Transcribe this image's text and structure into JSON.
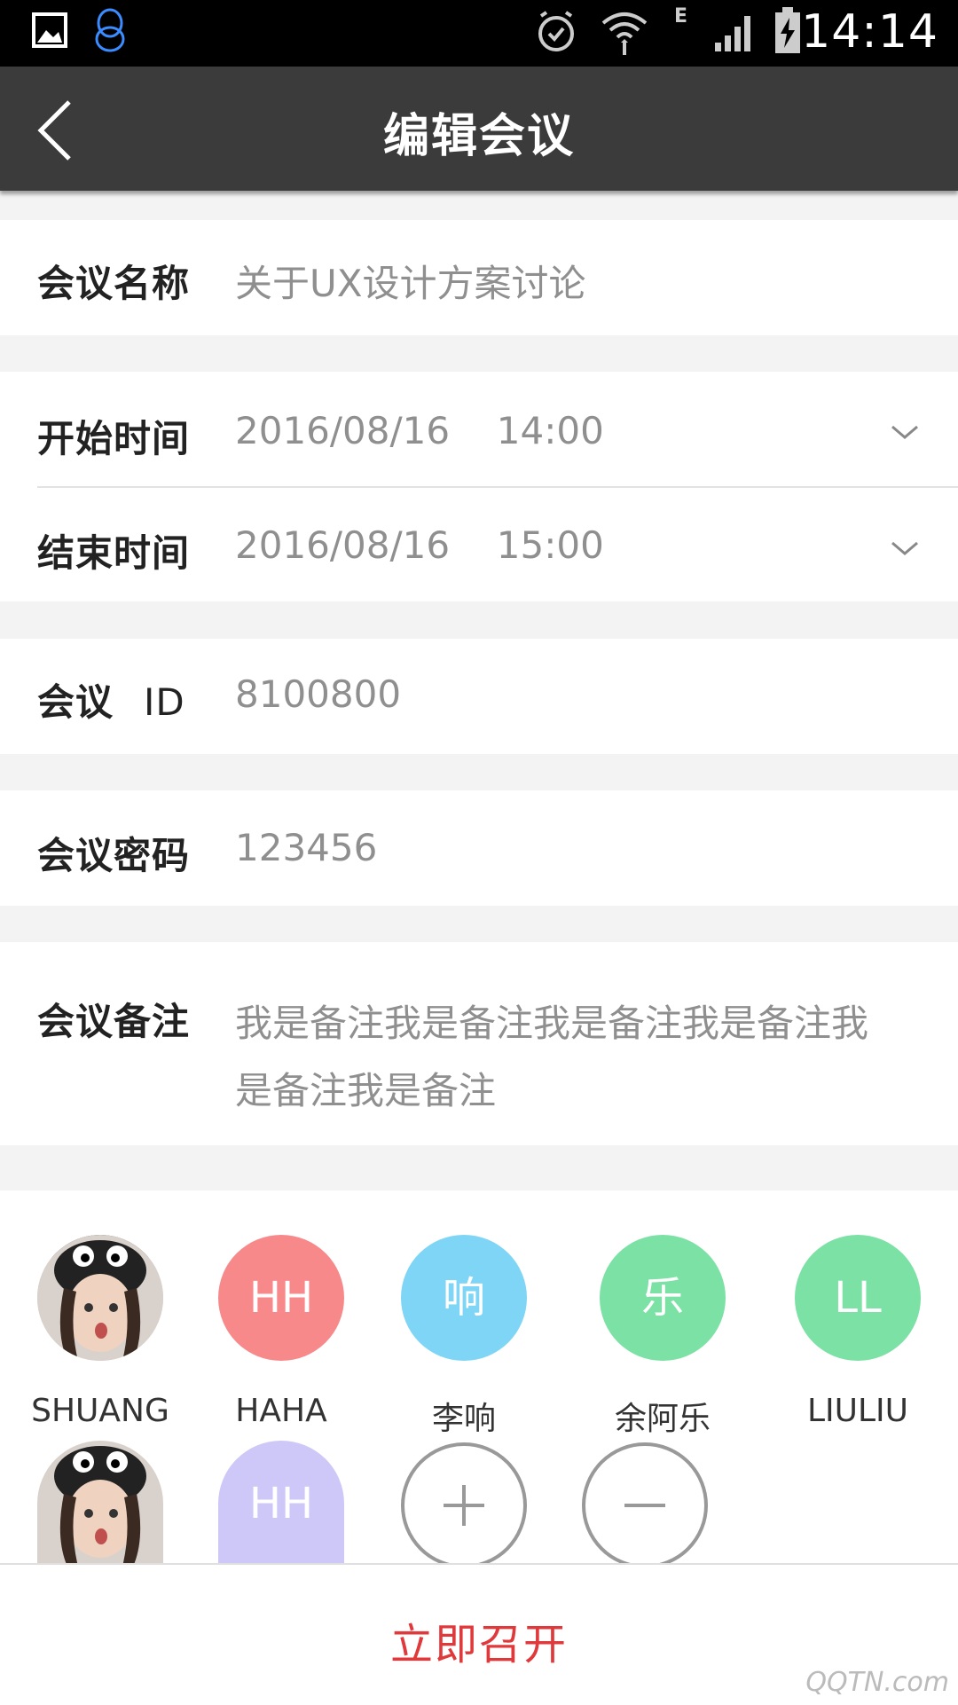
{
  "status_bar": {
    "time": "14:14",
    "network_label": "E",
    "icons": [
      "image-icon",
      "qq-icon",
      "alarm-icon",
      "wifi-icon",
      "signal-icon",
      "battery-charging-icon"
    ]
  },
  "header": {
    "title": "编辑会议",
    "back_icon": "chevron-left-icon"
  },
  "form": {
    "name": {
      "label": "会议名称",
      "value": "关于UX设计方案讨论"
    },
    "start": {
      "label": "开始时间",
      "date": "2016/08/16",
      "time": "14:00"
    },
    "end": {
      "label": "结束时间",
      "date": "2016/08/16",
      "time": "15:00"
    },
    "meeting_id": {
      "label_main": "会议",
      "label_suffix": "ID",
      "value": "8100800"
    },
    "password": {
      "label": "会议密码",
      "value": "123456"
    },
    "notes": {
      "label": "会议备注",
      "line1": "我是备注我是备注我是备注我是备注我",
      "line2": "是备注我是备注"
    }
  },
  "members": [
    {
      "name": "SHUANG",
      "initials": "",
      "type": "photo"
    },
    {
      "name": "HAHA",
      "initials": "HH",
      "color": "#f7898b"
    },
    {
      "name": "李响",
      "initials": "响",
      "color": "#7fd5f5"
    },
    {
      "name": "余阿乐",
      "initials": "乐",
      "color": "#7ce1a4"
    },
    {
      "name": "LIULIU",
      "initials": "LL",
      "color": "#7ce1a4"
    },
    {
      "name": "",
      "initials": "",
      "type": "photo"
    },
    {
      "name": "",
      "initials": "HH",
      "color": "#cdc8f7"
    }
  ],
  "actions": {
    "add_icon": "plus-icon",
    "remove_icon": "minus-icon",
    "start_label": "立即召开",
    "accent": "#e0393b"
  },
  "watermark": "QQTN.com"
}
